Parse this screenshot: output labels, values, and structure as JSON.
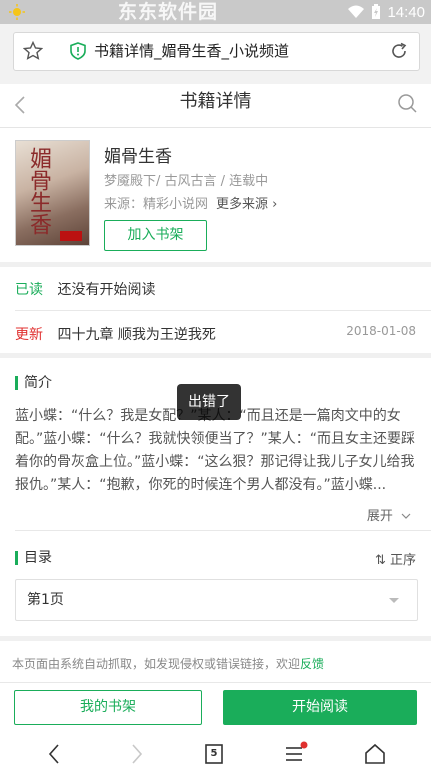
{
  "status_bar": {
    "time": "14:40",
    "watermark": "东东软件园"
  },
  "browser": {
    "url_title": "书籍详情_媚骨生香_小说频道"
  },
  "header": {
    "title": "书籍详情"
  },
  "book": {
    "cover_title": "媚骨生香",
    "name": "媚骨生香",
    "meta": "梦魇殿下/ 古风古言 / 连载中",
    "source_label": "来源：精彩小说网",
    "more_sources": "更多来源",
    "add_shelf": "加入书架"
  },
  "progress": {
    "read_label": "已读",
    "read_value": "还没有开始阅读",
    "update_label": "更新",
    "update_value": "四十九章 顺我为王逆我死",
    "update_date": "2018-01-08"
  },
  "intro": {
    "title": "简介",
    "text": "蓝小蝶：“什么？我是女配？”某人：“而且还是一篇肉文中的女配。”蓝小蝶：“什么？我就快领便当了？”某人：“而且女主还要踩着你的骨灰盒上位。”蓝小蝶：“这么狠？那记得让我儿子女儿给我报仇。”某人：“抱歉，你死的时候连个男人都没有。”蓝小蝶...",
    "expand": "展开"
  },
  "toc": {
    "title": "目录",
    "sort": "正序",
    "selected_page": "第1页"
  },
  "notice": {
    "text": "本页面由系统自动抓取，如发现侵权或错误链接，欢迎",
    "feedback": "反馈"
  },
  "actions": {
    "my_shelf": "我的书架",
    "start_read": "开始阅读"
  },
  "toast": {
    "text": "出错了"
  },
  "nav": {
    "tab_count": "5"
  },
  "colors": {
    "accent": "#1aad5a",
    "update_red": "#e0302f"
  }
}
